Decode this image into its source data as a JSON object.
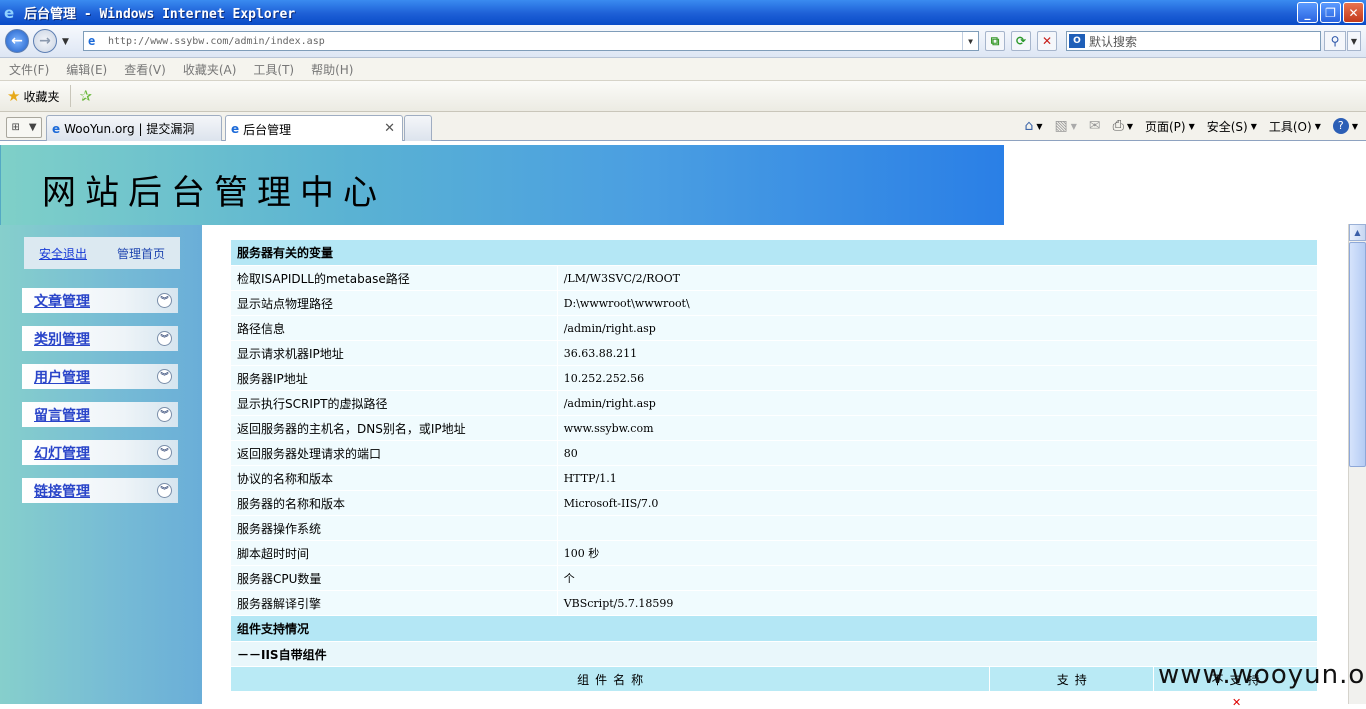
{
  "window": {
    "title": "后台管理 - Windows Internet Explorer"
  },
  "address": {
    "url": "http://www.ssybw.com/admin/index.asp"
  },
  "search": {
    "placeholder": "默认搜索"
  },
  "menubar": [
    "文件(F)",
    "编辑(E)",
    "查看(V)",
    "收藏夹(A)",
    "工具(T)",
    "帮助(H)"
  ],
  "favorites": {
    "label": "收藏夹"
  },
  "tabs": [
    {
      "label": "WooYun.org | 提交漏洞"
    },
    {
      "label": "后台管理"
    }
  ],
  "commands": {
    "page": "页面(P)",
    "safety": "安全(S)",
    "tools": "工具(O)"
  },
  "banner": {
    "title": "网站后台管理中心"
  },
  "sidebar": {
    "logout": "安全退出",
    "home": "管理首页",
    "items": [
      "文章管理",
      "类别管理",
      "用户管理",
      "留言管理",
      "幻灯管理",
      "链接管理"
    ]
  },
  "main": {
    "section1": "服务器有关的变量",
    "rows": [
      {
        "k": "检取ISAPIDLL的metabase路径",
        "v": "/LM/W3SVC/2/ROOT"
      },
      {
        "k": "显示站点物理路径",
        "v": "D:\\wwwroot\\wwwroot\\"
      },
      {
        "k": "路径信息",
        "v": "/admin/right.asp"
      },
      {
        "k": "显示请求机器IP地址",
        "v": "36.63.88.211"
      },
      {
        "k": "服务器IP地址",
        "v": "10.252.252.56"
      },
      {
        "k": "显示执行SCRIPT的虚拟路径",
        "v": "/admin/right.asp"
      },
      {
        "k": "返回服务器的主机名，DNS别名，或IP地址",
        "v": "www.ssybw.com"
      },
      {
        "k": "返回服务器处理请求的端口",
        "v": "80"
      },
      {
        "k": "协议的名称和版本",
        "v": "HTTP/1.1"
      },
      {
        "k": "服务器的名称和版本",
        "v": "Microsoft-IIS/7.0"
      },
      {
        "k": "服务器操作系统",
        "v": ""
      },
      {
        "k": "脚本超时时间",
        "v": "100 秒"
      },
      {
        "k": "服务器CPU数量",
        "v": "个"
      },
      {
        "k": "服务器解译引擎",
        "v": "VBScript/5.7.18599"
      }
    ],
    "section2": "组件支持情况",
    "subsection": "－－IIS自带组件",
    "cols": [
      "组件名称",
      "支持",
      "不支持"
    ]
  },
  "watermark": "www.wooyun.org"
}
